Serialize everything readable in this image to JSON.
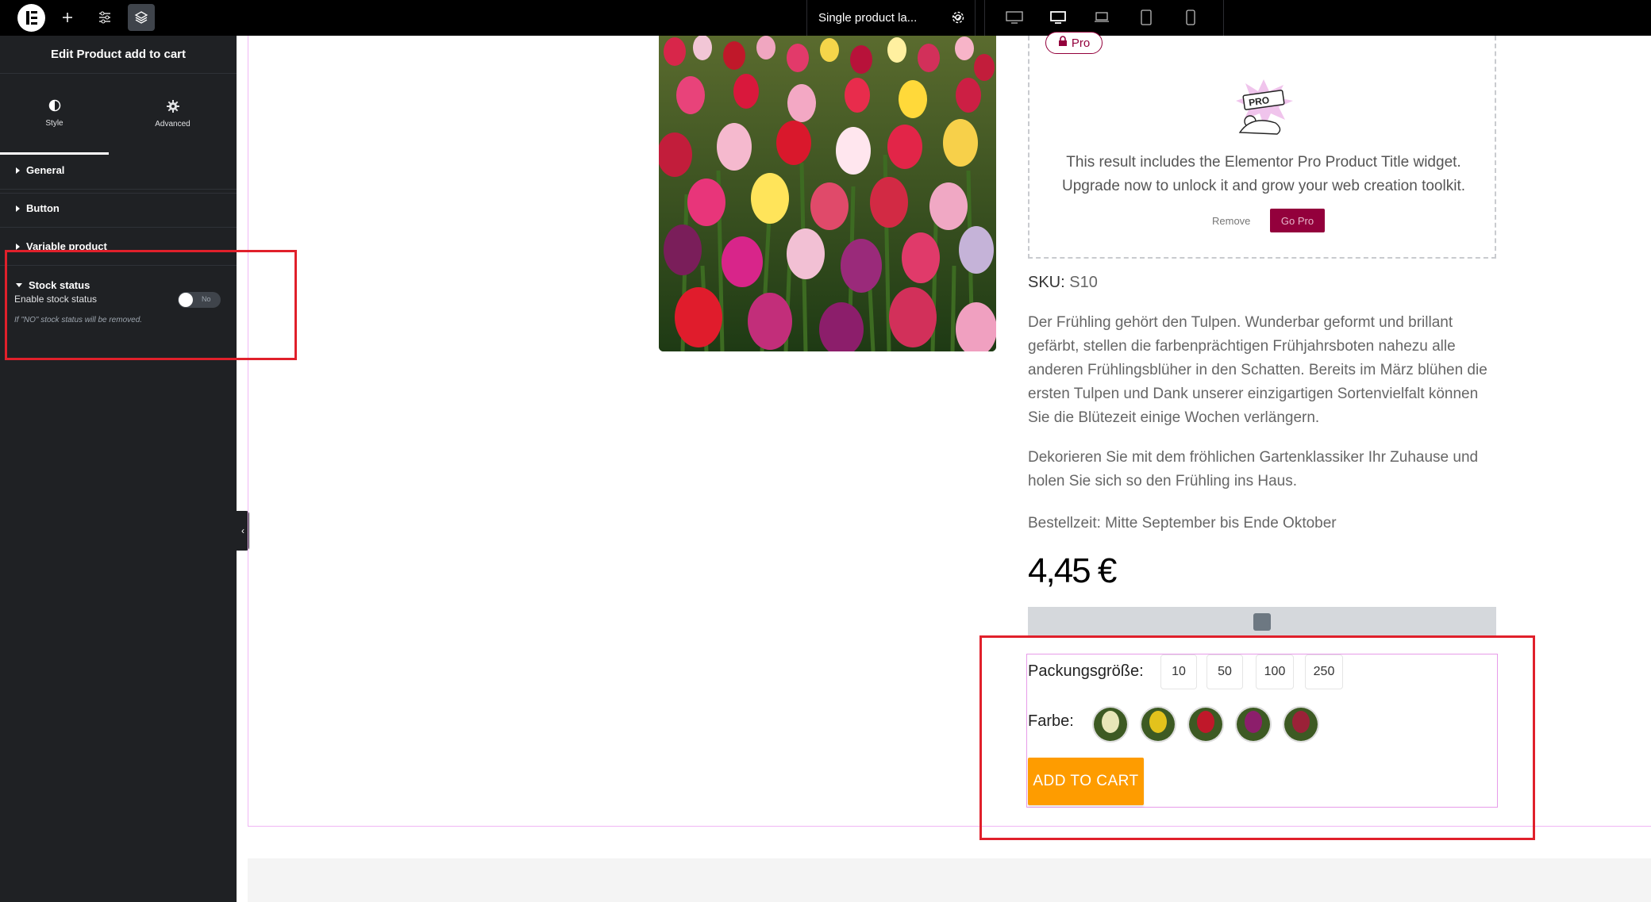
{
  "topbar": {
    "page_select_label": "Single product la...",
    "icons": [
      "elementor-logo-icon",
      "add-icon",
      "settings-sliders-icon",
      "structure-layers-icon",
      "chevron-down-icon",
      "gear-icon",
      "desktop-icon",
      "laptop-icon",
      "widescreen-icon",
      "tablet-icon",
      "mobile-icon"
    ]
  },
  "sidebar": {
    "title": "Edit Product add to cart",
    "tabs": [
      {
        "label": "Style",
        "icon": "contrast-icon",
        "active": true
      },
      {
        "label": "Advanced",
        "icon": "gear-icon",
        "active": false
      }
    ],
    "sections": [
      {
        "label": "General",
        "open": false
      },
      {
        "label": "Button",
        "open": false
      },
      {
        "label": "Variable product",
        "open": false
      },
      {
        "label": "Stock status",
        "open": true
      }
    ],
    "stock_status": {
      "control_label": "Enable stock status",
      "toggle_text": "No",
      "toggle_on": false,
      "help_text": "If \"NO\" stock status will be removed."
    }
  },
  "pro_notice": {
    "badge": "Pro",
    "text_line1": "This result includes the Elementor Pro Product Title widget.",
    "text_line2": "Upgrade now to unlock it and grow your web creation toolkit.",
    "remove_label": "Remove",
    "go_pro_label": "Go Pro",
    "illustration_text": "PRO"
  },
  "product": {
    "sku_label": "SKU:",
    "sku_value": "S10",
    "description_1": "Der Frühling gehört den Tulpen. Wunderbar geformt und brillant gefärbt, stellen die farbenprächtigen Frühjahrsboten nahezu alle anderen Frühlingsblüher in den Schatten. Bereits im März blühen die ersten Tulpen und Dank unserer einzigartigen Sortenvielfalt können Sie die Blütezeit einige Wochen verlängern.",
    "description_2": "Dekorieren Sie mit dem fröhlichen Gartenklassiker Ihr Zuhause und holen Sie sich so den Frühling ins Haus.",
    "description_3": "Bestellzeit: Mitte September bis Ende Oktober",
    "price": "4,45 €",
    "size_label": "Packungsgröße:",
    "sizes": [
      "10",
      "50",
      "100",
      "250"
    ],
    "color_label": "Farbe:",
    "swatch_colors": [
      "#e8e6b8",
      "#e3c21c",
      "#c0182a",
      "#8c1e6b",
      "#9b2238"
    ],
    "add_to_cart": "ADD TO CART"
  },
  "colors": {
    "accent_pro": "#93003c",
    "add_to_cart": "#fe9c00",
    "highlight_red": "#e0202b",
    "sidebar_bg": "#1f2124"
  }
}
